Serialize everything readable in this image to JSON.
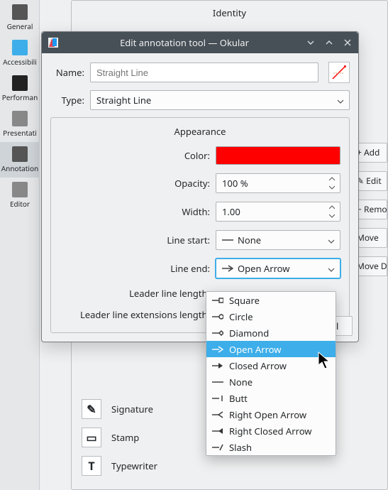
{
  "bgSidebar": [
    {
      "label": "General"
    },
    {
      "label": "Accessibili"
    },
    {
      "label": "Performan"
    },
    {
      "label": "Presentati"
    },
    {
      "label": "Annotation",
      "selected": true
    },
    {
      "label": "Editor"
    }
  ],
  "bgGroupHeader": "Identity",
  "bgRightButtons": [
    "+  Add",
    "✎  Edit",
    "−  Remo",
    "Move",
    "Move D"
  ],
  "bgList": [
    {
      "icon": "✎",
      "label": "Signature"
    },
    {
      "icon": "▭",
      "label": "Stamp"
    },
    {
      "icon": "T",
      "label": "Typewriter"
    }
  ],
  "dialog": {
    "title": "Edit annotation tool — Okular",
    "nameLabel": "Name:",
    "namePlaceholder": "Straight Line",
    "typeLabel": "Type:",
    "typeValue": "Straight Line",
    "group": {
      "title": "Appearance",
      "colorLabel": "Color:",
      "color": "#ff0000",
      "opacityLabel": "Opacity:",
      "opacityValue": "100 %",
      "widthLabel": "Width:",
      "widthValue": "1.00",
      "lineStartLabel": "Line start:",
      "lineStartValue": "None",
      "lineEndLabel": "Line end:",
      "lineEndValue": "Open Arrow",
      "leaderLineLabel": "Leader line length:",
      "leaderExtLabel": "Leader line extensions length:"
    },
    "footerBtn": "el"
  },
  "dropdown": {
    "items": [
      "Square",
      "Circle",
      "Diamond",
      "Open Arrow",
      "Closed Arrow",
      "None",
      "Butt",
      "Right Open Arrow",
      "Right Closed Arrow",
      "Slash"
    ],
    "highlightIndex": 3
  }
}
